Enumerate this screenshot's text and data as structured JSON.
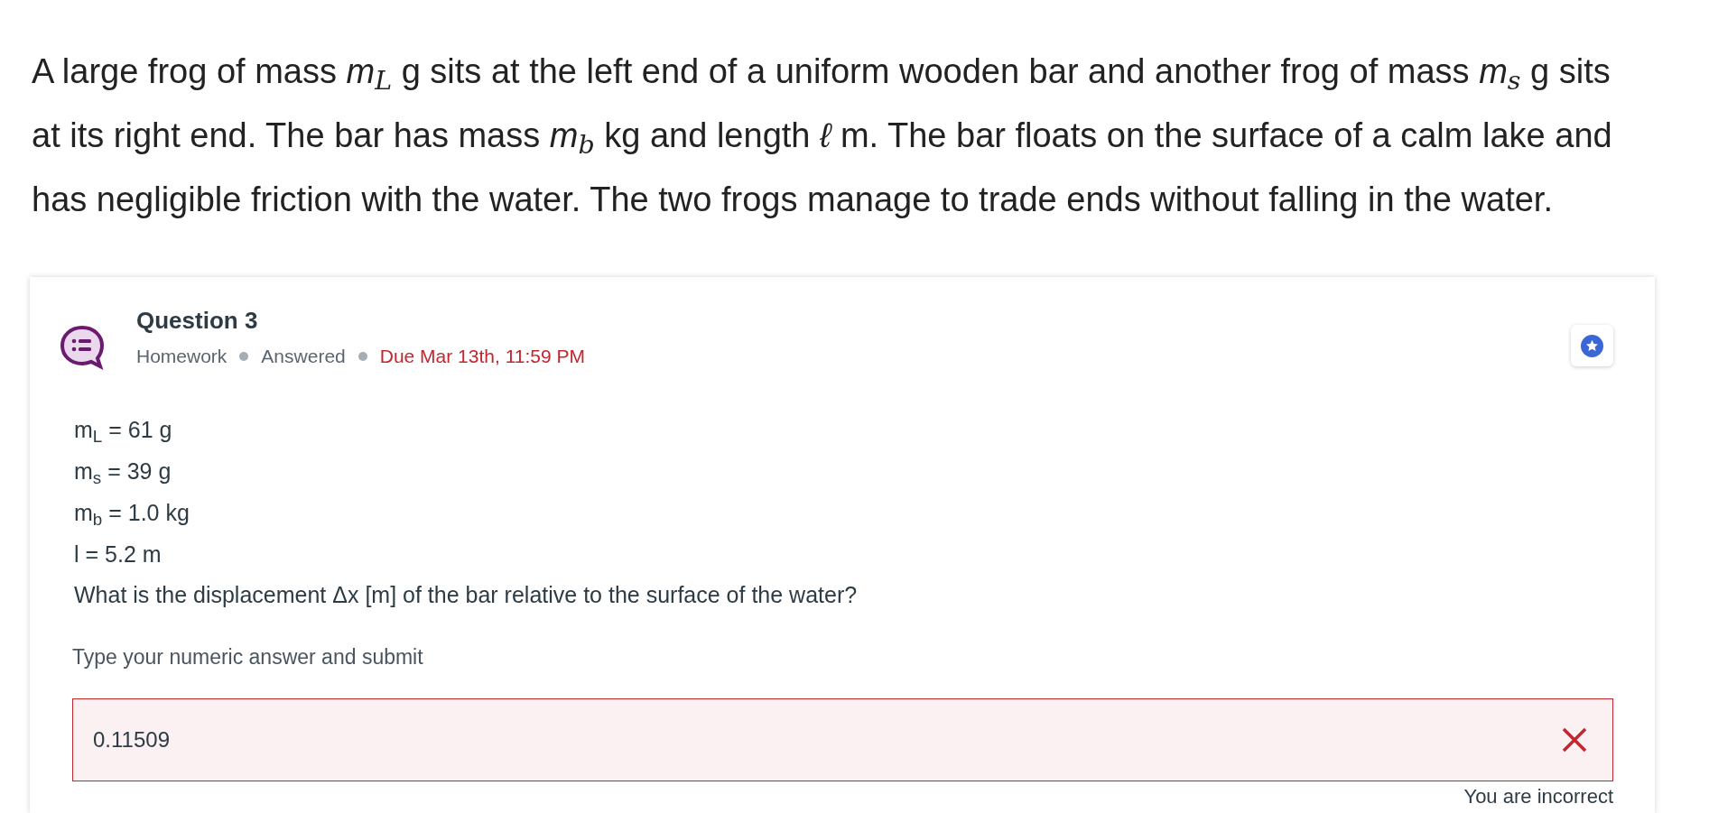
{
  "intro": "A large frog of mass *m*$_{L}$ g sits at the left end of a uniform wooden bar and another frog of mass *m*$_{s}$ g sits at its right end. The bar has mass *m*$_{b}$ kg and length *ℓ* m. The bar floats on the surface of a calm lake and has negligible friction with the water. The two frogs manage to trade ends without falling in the water.",
  "question": {
    "title": "Question 3",
    "meta": [
      {
        "text": "Homework",
        "kind": "plain"
      },
      {
        "text": "Answered",
        "kind": "plain"
      },
      {
        "text": "Due Mar 13th, 11:59 PM",
        "kind": "due"
      }
    ],
    "givens": [
      "m$_{L}$ = 61 g",
      "m$_{s}$ = 39 g",
      "m$_{b}$ = 1.0 kg",
      "l = 5.2 m"
    ],
    "prompt": "What is the displacement Δx [m] of the bar relative to the surface of the water?",
    "answer_label": "Type your numeric answer and submit",
    "answer": {
      "value": "0.11509",
      "correct": false
    },
    "feedback": "You are incorrect"
  }
}
